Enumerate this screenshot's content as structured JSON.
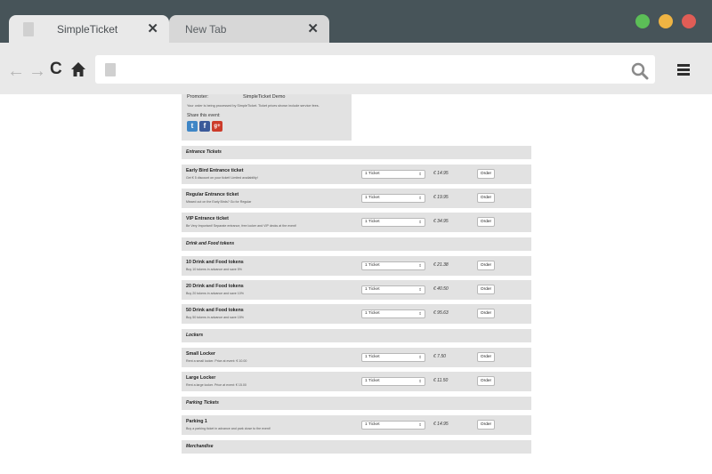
{
  "browser": {
    "tabs": [
      {
        "title": "SimpleTicket",
        "close": "✕"
      },
      {
        "title": "New Tab",
        "close": "✕"
      }
    ],
    "nav": {
      "back": "←",
      "forward": "→",
      "reload": "C"
    },
    "address": {
      "value": ""
    },
    "colors": {
      "titlebar": "#475459",
      "toolbar": "#e9e9e9",
      "green": "#5cbe57",
      "yellow": "#efb443",
      "red": "#e05d56"
    }
  },
  "event": {
    "promoter_label": "Promoter:",
    "promoter_value": "SimpleTicket Demo",
    "note": "Your order is being processed by SimpleTicket. Ticket prices shown include service fees.",
    "share_label": "Share this event:",
    "share_icons": [
      {
        "name": "twitter-icon",
        "glyph": "t"
      },
      {
        "name": "facebook-icon",
        "glyph": "f"
      },
      {
        "name": "google-plus-icon",
        "glyph": "g+"
      }
    ]
  },
  "sections": [
    {
      "title": "Entrance Tickets",
      "items": [
        {
          "name": "Early Bird Entrance ticket",
          "desc": "Get € 5 discount on your ticket! Limited availability!",
          "qty": "1 Ticket",
          "price": "€ 14.95",
          "button": "Order"
        },
        {
          "name": "Regular Entrance ticket",
          "desc": "Missed out on the Early Birds? Go for Regular",
          "qty": "1 Ticket",
          "price": "€ 19.95",
          "button": "Order"
        },
        {
          "name": "VIP Entrance ticket",
          "desc": "Be Very Important! Separate entrance, free locker and VIP decks at the event!",
          "qty": "1 Ticket",
          "price": "€ 34.95",
          "button": "Order"
        }
      ]
    },
    {
      "title": "Drink and Food tokens",
      "items": [
        {
          "name": "10 Drink and Food tokens",
          "desc": "Buy 10 tokens in advance and save 5%",
          "qty": "1 Ticket",
          "price": "€ 21.38",
          "button": "Order"
        },
        {
          "name": "20 Drink and Food tokens",
          "desc": "Buy 20 tokens in advance and save 10%",
          "qty": "1 Ticket",
          "price": "€ 40.50",
          "button": "Order"
        },
        {
          "name": "50 Drink and Food tokens",
          "desc": "Buy 50 tokens in advance and save 15%",
          "qty": "1 Ticket",
          "price": "€ 95.63",
          "button": "Order"
        }
      ]
    },
    {
      "title": "Lockers",
      "items": [
        {
          "name": "Small Locker",
          "desc": "Rent a small locker. Price at event: € 10.00",
          "qty": "1 Ticket",
          "price": "€ 7.50",
          "button": "Order"
        },
        {
          "name": "Large Locker",
          "desc": "Rent a large locker. Price at event: € 15.00",
          "qty": "1 Ticket",
          "price": "€ 11.50",
          "button": "Order"
        }
      ]
    },
    {
      "title": "Parking Tickets",
      "items": [
        {
          "name": "Parking 1",
          "desc": "Buy a parking ticket in advance and park close to the event!",
          "qty": "1 Ticket",
          "price": "€ 14.95",
          "button": "Order"
        }
      ]
    },
    {
      "title": "Merchandise",
      "items": []
    }
  ]
}
